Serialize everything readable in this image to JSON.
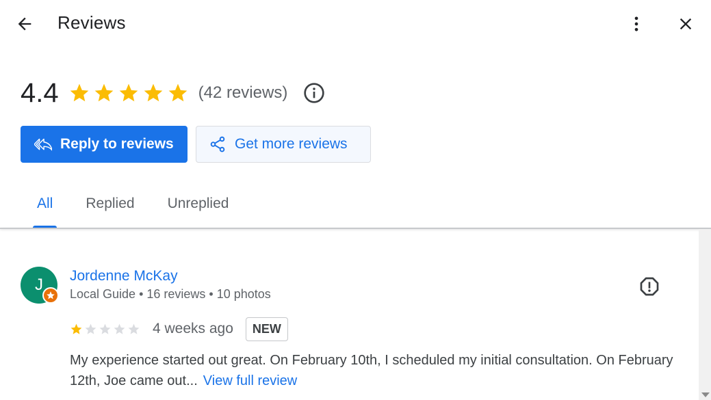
{
  "header": {
    "title": "Reviews",
    "back_icon": "arrow-back-icon",
    "more_icon": "more-vert-icon",
    "close_icon": "close-icon"
  },
  "summary": {
    "rating": "4.4",
    "star_count": 5,
    "reviews_count": "(42 reviews)",
    "info_icon": "info-icon"
  },
  "actions": {
    "reply_label": "Reply to reviews",
    "reply_icon": "reply-all-icon",
    "get_more_label": "Get more reviews",
    "get_more_icon": "share-icon"
  },
  "tabs": [
    {
      "label": "All",
      "active": true
    },
    {
      "label": "Replied",
      "active": false
    },
    {
      "label": "Unreplied",
      "active": false
    }
  ],
  "reviews": [
    {
      "avatar_initial": "J",
      "name": "Jordenne McKay",
      "meta": "Local Guide • 16 reviews • 10 photos",
      "stars": 1,
      "max_stars": 5,
      "age": "4 weeks ago",
      "badge": "NEW",
      "text": "My experience started out great. On February 10th, I scheduled my initial consultation. On February 12th, Joe came out...",
      "view_full_label": "View full review",
      "flag_icon": "report-icon"
    }
  ],
  "colors": {
    "accent": "#1a73e8",
    "star": "#fbbc04",
    "star_empty": "#dadce0",
    "avatar_bg": "#0b8f6e",
    "guide_badge": "#e8710a"
  }
}
